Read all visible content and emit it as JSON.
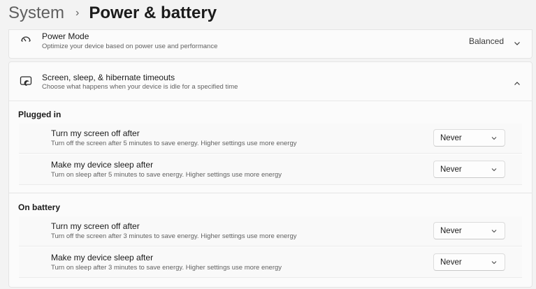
{
  "breadcrumb": {
    "parent": "System",
    "separator": "›",
    "current": "Power & battery"
  },
  "power_mode": {
    "icon": "power-mode-gauge-icon",
    "title": "Power Mode",
    "description": "Optimize your device based on power use and performance",
    "value": "Balanced"
  },
  "sleep": {
    "icon": "screen-sleep-icon",
    "title": "Screen, sleep, & hibernate timeouts",
    "description": "Choose what happens when your device is idle for a specified time",
    "expanded": true,
    "plugged_in": {
      "label": "Plugged in",
      "rows": [
        {
          "title": "Turn my screen off after",
          "description": "Turn off the screen after 5 minutes to save energy. Higher settings use more energy",
          "value": "Never"
        },
        {
          "title": "Make my device sleep after",
          "description": "Turn on sleep after 5 minutes to save energy. Higher settings use more energy",
          "value": "Never"
        }
      ]
    },
    "on_battery": {
      "label": "On battery",
      "rows": [
        {
          "title": "Turn my screen off after",
          "description": "Turn off the screen after 3 minutes to save energy. Higher settings use more energy",
          "value": "Never"
        },
        {
          "title": "Make my device sleep after",
          "description": "Turn on sleep after 3 minutes to save energy. Higher settings use more energy",
          "value": "Never"
        }
      ]
    }
  }
}
